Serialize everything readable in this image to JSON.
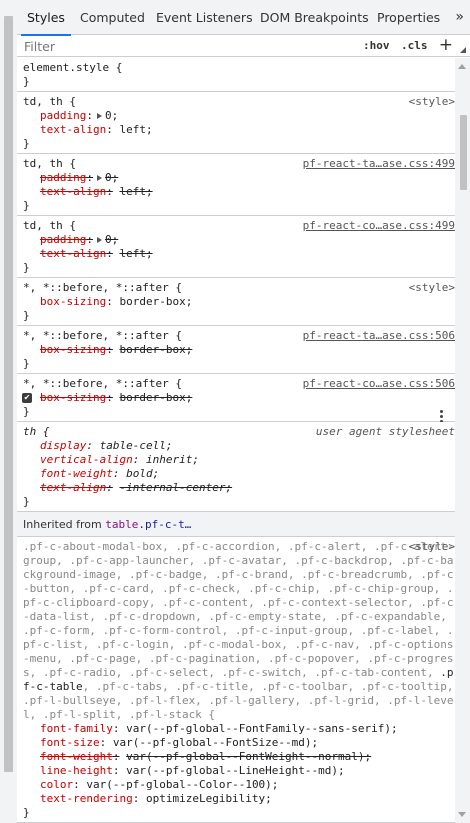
{
  "tabs": [
    "Styles",
    "Computed",
    "Event Listeners",
    "DOM Breakpoints",
    "Properties"
  ],
  "tab_overflow": "»",
  "filter": {
    "placeholder": "Filter",
    "hov": ":hov",
    "cls": ".cls",
    "plus": "+"
  },
  "rules": [
    {
      "selector": "element.style {",
      "source": "",
      "decls": []
    },
    {
      "selector": "td, th {",
      "source": "<style>",
      "decls": [
        {
          "prop": "padding",
          "value": "0;",
          "expandable": true,
          "struck": false
        },
        {
          "prop": "text-align",
          "value": "left;",
          "struck": false
        }
      ]
    },
    {
      "selector": "td, th {",
      "source": "pf-react-ta…ase.css:499",
      "decls": [
        {
          "prop": "padding",
          "value": "0;",
          "expandable": true,
          "struck": true
        },
        {
          "prop": "text-align",
          "value": "left;",
          "struck": true
        }
      ]
    },
    {
      "selector": "td, th {",
      "source": "pf-react-co…ase.css:499",
      "decls": [
        {
          "prop": "padding",
          "value": "0;",
          "expandable": true,
          "struck": true
        },
        {
          "prop": "text-align",
          "value": "left;",
          "struck": true
        }
      ]
    },
    {
      "selector": "*, *::before, *::after {",
      "source": "<style>",
      "decls": [
        {
          "prop": "box-sizing",
          "value": "border-box;",
          "struck": false
        }
      ]
    },
    {
      "selector": "*, *::before, *::after {",
      "source": "pf-react-ta…ase.css:506",
      "decls": [
        {
          "prop": "box-sizing",
          "value": "border-box;",
          "struck": true
        }
      ]
    },
    {
      "selector": "*, *::before, *::after {",
      "source": "pf-react-co…ase.css:506",
      "decls": [
        {
          "prop": "box-sizing",
          "value": "border-box;",
          "struck": true,
          "checked": true
        }
      ]
    }
  ],
  "ua_rule": {
    "selector": "th {",
    "source": "user agent stylesheet",
    "decls": [
      {
        "prop": "display",
        "value": "table-cell;",
        "struck": false
      },
      {
        "prop": "vertical-align",
        "value": "inherit;",
        "struck": false
      },
      {
        "prop": "font-weight",
        "value": "bold;",
        "struck": false
      },
      {
        "prop": "text-align",
        "value": "-internal-center;",
        "struck": true
      }
    ]
  },
  "inherited": {
    "label": "Inherited from ",
    "element": "table",
    "classes": ".pf-c-t…"
  },
  "inherited_rule": {
    "selector_before": ".pf-c-about-modal-box, .pf-c-accordion, .pf-c-alert, .pf-c-alert-group, .pf-c-app-launcher, .pf-c-avatar, .pf-c-backdrop, .pf-c-background-image, .pf-c-badge, .pf-c-brand, .pf-c-breadcrumb, .pf-c-button, .pf-c-card, .pf-c-check, .pf-c-chip, .pf-c-chip-group, .pf-c-clipboard-copy, .pf-c-content, .pf-c-context-selector, .pf-c-data-list, .pf-c-dropdown, .pf-c-empty-state, .pf-c-expandable, .pf-c-form, .pf-c-form-control, .pf-c-input-group, .pf-c-label, .pf-c-list, .pf-c-login, .pf-c-modal-box, .pf-c-nav, .pf-c-options-menu, .pf-c-page, .pf-c-pagination, .pf-c-popover, .pf-c-progress, .pf-c-radio, .pf-c-select, .pf-c-switch, .pf-c-tab-content, ",
    "selector_match": ".pf-c-table",
    "selector_after": ", .pf-c-tabs, .pf-c-title, .pf-c-toolbar, .pf-c-tooltip, .pf-l-bullseye, .pf-l-flex, .pf-l-gallery, .pf-l-grid, .pf-l-level, .pf-l-split, .pf-l-stack {",
    "source": "<style>",
    "decls": [
      {
        "prop": "font-family",
        "value": "var(--pf-global--FontFamily--sans-serif);",
        "struck": false
      },
      {
        "prop": "font-size",
        "value": "var(--pf-global--FontSize--md);",
        "struck": false
      },
      {
        "prop": "font-weight",
        "value": "var(--pf-global--FontWeight--normal);",
        "struck": true
      },
      {
        "prop": "line-height",
        "value": "var(--pf-global--LineHeight--md);",
        "struck": false
      },
      {
        "prop": "color",
        "value": "var(--pf-global--Color--100);",
        "struck": false
      },
      {
        "prop": "text-rendering",
        "value": "optimizeLegibility;",
        "struck": false
      }
    ]
  },
  "closing_brace": "}"
}
